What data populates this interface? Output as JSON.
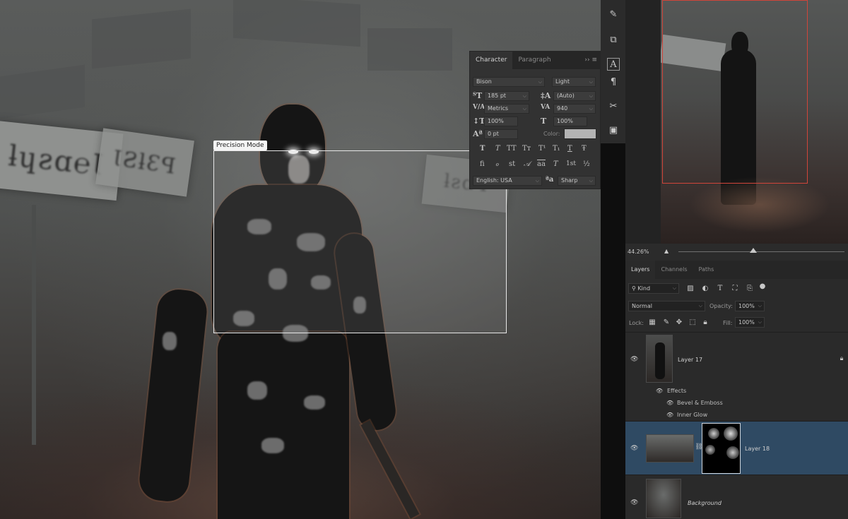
{
  "canvas": {
    "sign_glyphs": [
      "ƚɥƨɑ℮Ɩ",
      "ƖƧƚƐꟼ",
      "ƚƨɑꟼ"
    ],
    "precision_label": "Precision Mode"
  },
  "character_panel": {
    "tabs": [
      "Character",
      "Paragraph"
    ],
    "active_tab": "Character",
    "menu_icons": "›› ≡",
    "font_family": "Bison",
    "font_style": "Light",
    "font_size": "185 pt",
    "leading": "(Auto)",
    "kerning": "Metrics",
    "tracking": "940",
    "vertical_scale": "100%",
    "horizontal_scale": "100%",
    "baseline_shift": "0 pt",
    "color_label": "Color:",
    "color_value": "#b3b3b3",
    "type_style_buttons": [
      "T",
      "T",
      "TT",
      "Tт",
      "T¹",
      "T₁",
      "T",
      "Ŧ"
    ],
    "opentype_buttons": [
      "ﬁ",
      "ℴ",
      "st",
      "𝒜",
      "aa",
      "T",
      "1st",
      "½"
    ],
    "language": "English: USA",
    "aa_label": "ªa",
    "antialias": "Sharp"
  },
  "vertical_toolbar": {
    "icons": [
      "brush-presets-icon",
      "clone-source-icon",
      "character-icon",
      "paragraph-icon",
      "tools-icon",
      "layer-comps-icon"
    ]
  },
  "navigator": {
    "zoom": "44.26%",
    "view_box_color": "#d0453a"
  },
  "layers_panel": {
    "tabs": [
      "Layers",
      "Channels",
      "Paths"
    ],
    "active_tab": "Layers",
    "filter_kind": "Kind",
    "blend_mode": "Normal",
    "opacity_label": "Opacity:",
    "opacity": "100%",
    "lock_label": "Lock:",
    "fill_label": "Fill:",
    "fill": "100%",
    "layers": [
      {
        "name": "Layer 17",
        "effects_label": "Effects",
        "effects": [
          "Bevel & Emboss",
          "Inner Glow"
        ]
      },
      {
        "name": "Layer 18",
        "selected": true
      },
      {
        "name": "Background",
        "italic": true
      }
    ],
    "selected_color": "#2f4a63"
  }
}
